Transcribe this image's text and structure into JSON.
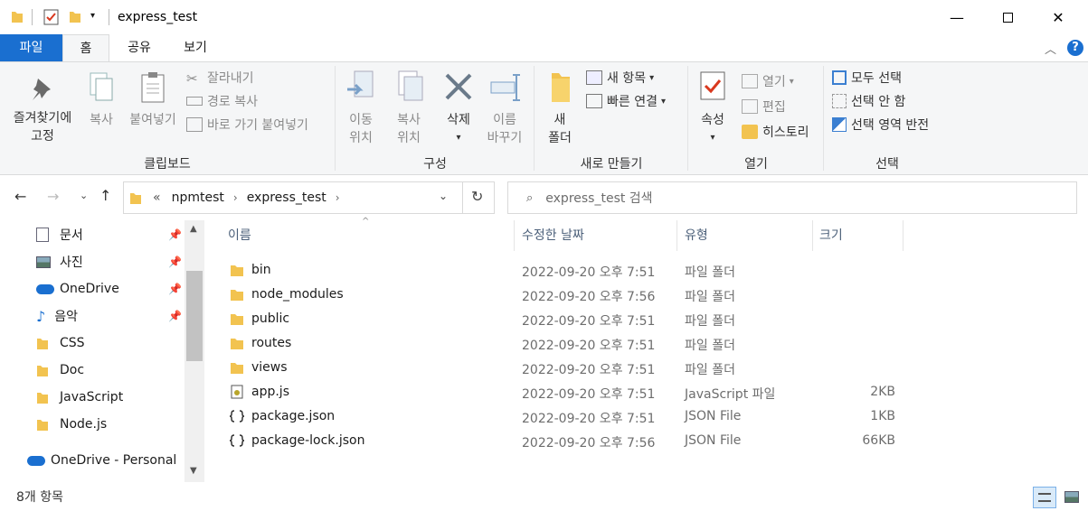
{
  "window": {
    "title": "express_test"
  },
  "tabs": [
    {
      "label": "파일"
    },
    {
      "label": "홈"
    },
    {
      "label": "공유"
    },
    {
      "label": "보기"
    }
  ],
  "ribbon": {
    "clipboard": {
      "label": "클립보드",
      "pin_line1": "즐겨찾기에",
      "pin_line2": "고정",
      "copy": "복사",
      "paste": "붙여넣기",
      "cut": "잘라내기",
      "copy_path": "경로 복사",
      "paste_shortcut": "바로 가기 붙여넣기"
    },
    "organize": {
      "label": "구성",
      "move_l1": "이동",
      "move_l2": "위치",
      "copyto_l1": "복사",
      "copyto_l2": "위치",
      "delete": "삭제",
      "rename_l1": "이름",
      "rename_l2": "바꾸기"
    },
    "new": {
      "label": "새로 만들기",
      "folder_l1": "새",
      "folder_l2": "폴더",
      "new_item": "새 항목",
      "easy_access": "빠른 연결"
    },
    "open": {
      "label": "열기",
      "properties": "속성",
      "open": "열기",
      "edit": "편집",
      "history": "히스토리"
    },
    "select": {
      "label": "선택",
      "select_all": "모두 선택",
      "select_none": "선택 안 함",
      "invert": "선택 영역 반전"
    }
  },
  "address": {
    "overflow": "«",
    "crumbs": [
      "npmtest",
      "express_test"
    ],
    "search_placeholder": "express_test 검색"
  },
  "sidebar": {
    "items": [
      {
        "label": "문서",
        "icon": "document-icon",
        "pinned": true
      },
      {
        "label": "사진",
        "icon": "picture-icon",
        "pinned": true
      },
      {
        "label": "OneDrive",
        "icon": "cloud-icon",
        "pinned": true
      },
      {
        "label": "음악",
        "icon": "music-icon",
        "pinned": true
      },
      {
        "label": "CSS",
        "icon": "folder-icon",
        "pinned": false
      },
      {
        "label": "Doc",
        "icon": "folder-icon",
        "pinned": false
      },
      {
        "label": "JavaScript",
        "icon": "folder-icon",
        "pinned": false
      },
      {
        "label": "Node.js",
        "icon": "folder-icon",
        "pinned": false
      }
    ],
    "onedrive_personal": "OneDrive - Personal"
  },
  "columns": {
    "name": "이름",
    "date": "수정한 날짜",
    "type": "유형",
    "size": "크기"
  },
  "files": [
    {
      "name": "bin",
      "date": "2022-09-20 오후 7:51",
      "type": "파일 폴더",
      "size": "",
      "kind": "folder"
    },
    {
      "name": "node_modules",
      "date": "2022-09-20 오후 7:56",
      "type": "파일 폴더",
      "size": "",
      "kind": "folder"
    },
    {
      "name": "public",
      "date": "2022-09-20 오후 7:51",
      "type": "파일 폴더",
      "size": "",
      "kind": "folder"
    },
    {
      "name": "routes",
      "date": "2022-09-20 오후 7:51",
      "type": "파일 폴더",
      "size": "",
      "kind": "folder"
    },
    {
      "name": "views",
      "date": "2022-09-20 오후 7:51",
      "type": "파일 폴더",
      "size": "",
      "kind": "folder"
    },
    {
      "name": "app.js",
      "date": "2022-09-20 오후 7:51",
      "type": "JavaScript 파일",
      "size": "2KB",
      "kind": "js"
    },
    {
      "name": "package.json",
      "date": "2022-09-20 오후 7:51",
      "type": "JSON File",
      "size": "1KB",
      "kind": "json"
    },
    {
      "name": "package-lock.json",
      "date": "2022-09-20 오후 7:56",
      "type": "JSON File",
      "size": "66KB",
      "kind": "json"
    }
  ],
  "status": {
    "count": "8개 항목"
  },
  "colors": {
    "accent": "#1a6fd0",
    "folder": "#f2c350",
    "ribbon_bg": "#f5f6f7"
  }
}
